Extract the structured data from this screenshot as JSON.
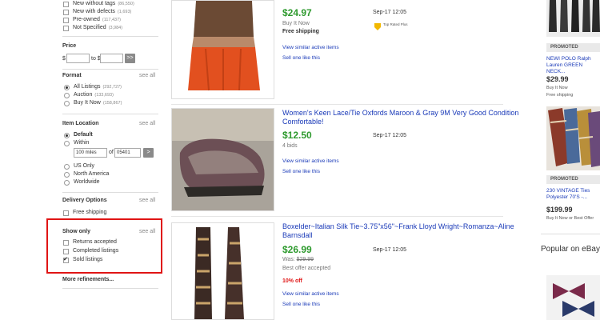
{
  "condition": {
    "items": [
      {
        "label": "New without tags",
        "count": "(86,550)"
      },
      {
        "label": "New with defects",
        "count": "(1,693)"
      },
      {
        "label": "Pre-owned",
        "count": "(117,437)"
      },
      {
        "label": "Not Specified",
        "count": "(3,984)"
      }
    ]
  },
  "price": {
    "title": "Price",
    "currency": "$",
    "to": "to $",
    "min_value": "",
    "max_value": "",
    "go_label": ">>"
  },
  "format": {
    "title": "Format",
    "see_all": "see all",
    "items": [
      {
        "label": "All Listings",
        "count": "(292,727)",
        "checked": true
      },
      {
        "label": "Auction",
        "count": "(133,693)",
        "checked": false
      },
      {
        "label": "Buy It Now",
        "count": "(158,867)",
        "checked": false
      }
    ]
  },
  "location": {
    "title": "Item Location",
    "see_all": "see all",
    "default_label": "Default",
    "within_label": "Within",
    "miles_value": "100 miles",
    "of_label": "of",
    "zip_value": "05401",
    "go_label": ">",
    "other_items": [
      "US Only",
      "North America",
      "Worldwide"
    ]
  },
  "delivery": {
    "title": "Delivery Options",
    "see_all": "see all",
    "items": [
      "Free shipping"
    ]
  },
  "show_only": {
    "title": "Show only",
    "see_all": "see all",
    "items": [
      {
        "label": "Returns accepted",
        "checked": false
      },
      {
        "label": "Completed listings",
        "checked": false
      },
      {
        "label": "Sold listings",
        "checked": true
      }
    ]
  },
  "more_refinements": "More refinements...",
  "listings": [
    {
      "title": "...",
      "price": "$24.97",
      "line2": "Buy It Now",
      "line3": "Free shipping",
      "date": "Sep-17 12:05",
      "badge_text": "Top Rated Plus",
      "link1": "View similar active items",
      "link2": "Sell one like this"
    },
    {
      "title": "Women's Keen Lace/Tie Oxfords Maroon & Gray 9M Very Good Condition Comfortable!",
      "price": "$12.50",
      "line2": "4 bids",
      "date": "Sep-17 12:05",
      "link1": "View similar active items",
      "link2": "Sell one like this"
    },
    {
      "title": "Boxelder~Italian Silk Tie~3.75\"x56\"~Frank Lloyd Wright~Romanza~Aline Barnsdall",
      "price": "$26.99",
      "was_label": "Was:",
      "was_price": "$29.99",
      "line3": "Best offer accepted",
      "off": "10% off",
      "date": "Sep-17 12:05",
      "link1": "View similar active items",
      "link2": "Sell one like this"
    }
  ],
  "rail": {
    "items": [
      {
        "promoted": "PROMOTED",
        "title": "NEWI POLO Ralph Lauren GREEN NECK...",
        "price": "$29.99",
        "line1": "Buy It Now",
        "line2": "Free shipping"
      },
      {
        "promoted": "PROMOTED",
        "title": "230 VINTAGE Ties Polyester 70'S -...",
        "price": "$199.99",
        "line1": "Buy It Now or Best Offer"
      }
    ],
    "popular": "Popular on eBay"
  },
  "colors": {
    "link": "#1a3ab8",
    "price": "#2e9a2e",
    "highlight_box": "#e01515"
  }
}
